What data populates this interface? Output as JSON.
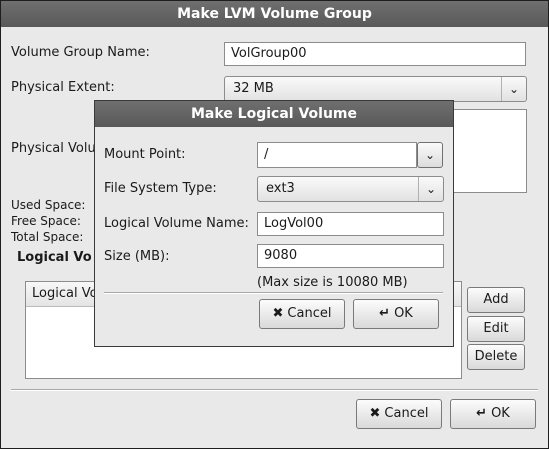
{
  "main_window": {
    "title": "Make LVM Volume Group",
    "volume_group_name_label": "Volume Group Name:",
    "volume_group_name_value": "VolGroup00",
    "physical_extent_label": "Physical Extent:",
    "physical_extent_value": "32 MB",
    "physical_volumes_label": "Physical Volu",
    "used_space_label": "Used Space:",
    "free_space_label": "Free Space:",
    "total_space_label": "Total Space:",
    "logical_volumes_heading": "Logical Vo",
    "lv_list_header": "Logical Vo",
    "add_label": "Add",
    "edit_label": "Edit",
    "delete_label": "Delete",
    "cancel_label": "Cancel",
    "ok_label": "OK"
  },
  "dialog": {
    "title": "Make Logical Volume",
    "mount_point_label": "Mount Point:",
    "mount_point_value": "/",
    "fs_type_label": "File System Type:",
    "fs_type_value": "ext3",
    "lv_name_label": "Logical Volume Name:",
    "lv_name_value": "LogVol00",
    "size_label": "Size (MB):",
    "size_value": "9080",
    "max_size_text": "(Max size is 10080 MB)",
    "cancel_label": "Cancel",
    "ok_label": "OK"
  },
  "icons": {
    "dropdown": "chevron-down-icon",
    "cancel": "cancel-x-icon",
    "ok": "enter-arrow-icon"
  }
}
